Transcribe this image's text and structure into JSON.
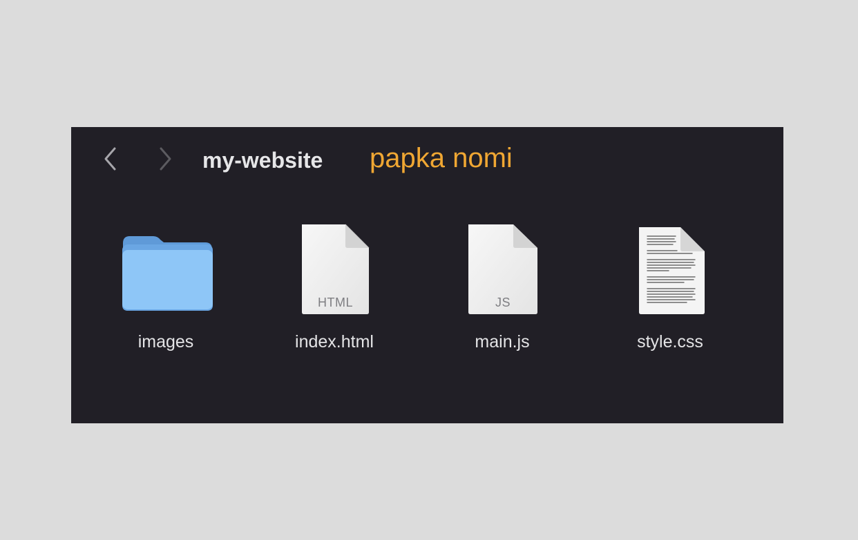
{
  "toolbar": {
    "back_icon": "chevron-left-icon",
    "forward_icon": "chevron-right-icon",
    "title": "my-website"
  },
  "annotation": {
    "label": "papka nomi",
    "color": "#f0a733"
  },
  "colors": {
    "window_background": "#211f26",
    "page_background": "#dcdcdc",
    "folder_blue": "#8ec6f7"
  },
  "files": [
    {
      "name": "images",
      "kind": "folder",
      "icon": "folder-icon"
    },
    {
      "name": "index.html",
      "kind": "document",
      "badge": "HTML",
      "icon": "html-file-icon"
    },
    {
      "name": "main.js",
      "kind": "document",
      "badge": "JS",
      "icon": "js-file-icon"
    },
    {
      "name": "style.css",
      "kind": "text-document",
      "icon": "css-file-icon"
    }
  ]
}
